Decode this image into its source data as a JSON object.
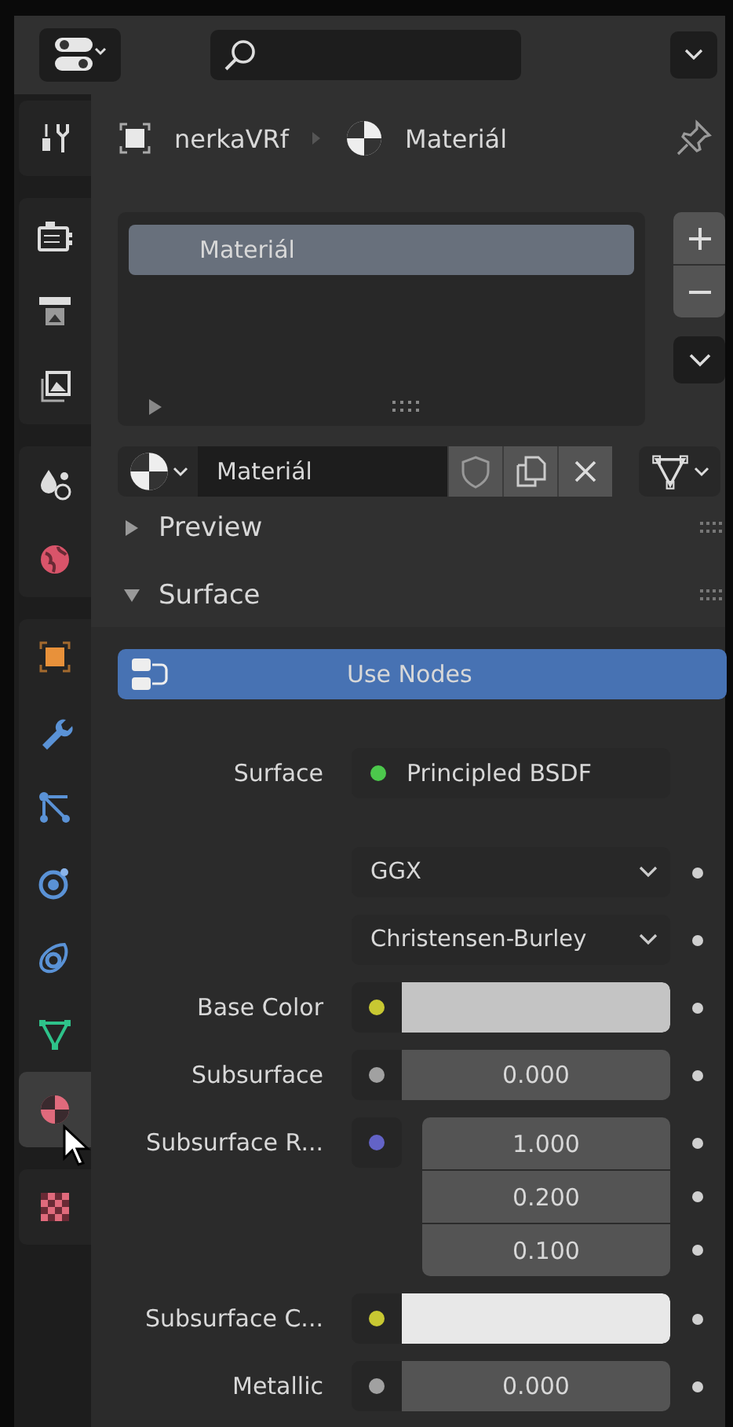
{
  "sidebar": {
    "groups": [
      {
        "tabs": [
          {
            "kind": "tool",
            "selected": false
          }
        ]
      },
      {
        "tabs": [
          {
            "kind": "render",
            "selected": false
          },
          {
            "kind": "output",
            "selected": false
          },
          {
            "kind": "view_layer",
            "selected": false
          }
        ]
      },
      {
        "tabs": [
          {
            "kind": "scene",
            "selected": false
          },
          {
            "kind": "world",
            "selected": false
          }
        ]
      },
      {
        "tabs": [
          {
            "kind": "object",
            "selected": false
          },
          {
            "kind": "modifier",
            "selected": false
          },
          {
            "kind": "particles",
            "selected": false
          },
          {
            "kind": "physics",
            "selected": false
          },
          {
            "kind": "constraints",
            "selected": false
          },
          {
            "kind": "data",
            "selected": false
          },
          {
            "kind": "material",
            "selected": true
          }
        ]
      },
      {
        "tabs": [
          {
            "kind": "texture",
            "selected": false
          }
        ]
      }
    ]
  },
  "breadcrumb": {
    "object": "nerkaVRf",
    "material": "Materiál"
  },
  "slots": {
    "items": [
      {
        "label": "Materiál",
        "selected": true
      }
    ]
  },
  "material_id": {
    "name": "Materiál"
  },
  "panels": [
    {
      "title": "Preview",
      "expanded": false
    },
    {
      "title": "Surface",
      "expanded": true,
      "use_nodes": {
        "label": "Use Nodes",
        "on": true
      },
      "properties": [
        {
          "kind": "shader",
          "label": "Surface",
          "socket": {
            "color": "#4cc84c"
          },
          "value": "Principled BSDF"
        },
        {
          "kind": "dropdown",
          "value": "GGX"
        },
        {
          "kind": "dropdown",
          "value": "Christensen-Burley"
        },
        {
          "kind": "color",
          "label": "Base Color",
          "socket": {
            "color": "#c8c832"
          },
          "swatch": {
            "color": "#c4c4c4"
          }
        },
        {
          "kind": "value",
          "label": "Subsurface",
          "socket": {
            "color": "#a1a1a1"
          },
          "value": "0.000"
        },
        {
          "kind": "vector",
          "label": "Subsurface R...",
          "socket": {
            "color": "#6363c7"
          },
          "values": [
            "1.000",
            "0.200",
            "0.100"
          ]
        },
        {
          "kind": "color",
          "label": "Subsurface C...",
          "socket": {
            "color": "#c8c832"
          },
          "swatch": {
            "color": "#e8e8e8"
          }
        },
        {
          "kind": "value",
          "label": "Metallic",
          "socket": {
            "color": "#a1a1a1"
          },
          "value": "0.000"
        }
      ]
    }
  ]
}
